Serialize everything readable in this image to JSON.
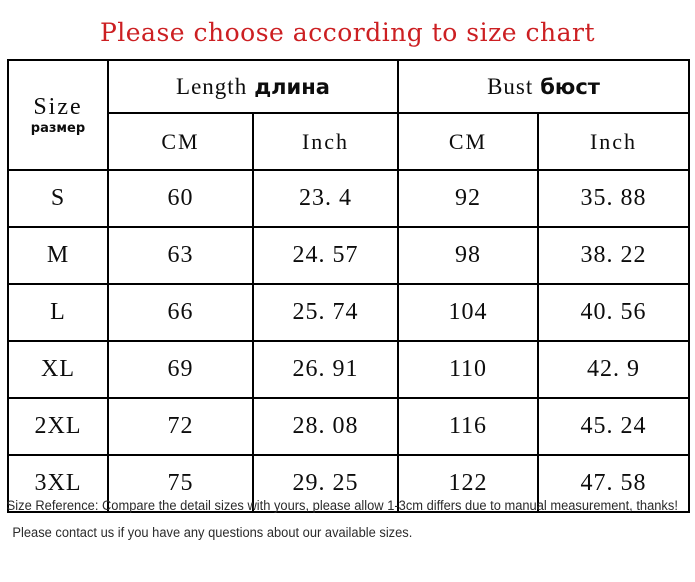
{
  "title": "Please choose according to size chart",
  "colors": {
    "title_red": "#cc1f22",
    "border": "#000000",
    "text": "#0d0d0d",
    "note_text": "#2b2b2b",
    "background": "#ffffff"
  },
  "table": {
    "size_header": {
      "english": "Size",
      "russian": "размер"
    },
    "groups": [
      {
        "english": "Length",
        "russian": "длина"
      },
      {
        "english": "Bust",
        "russian": "бюст"
      }
    ],
    "units": [
      "CM",
      "Inch",
      "CM",
      "Inch"
    ],
    "rows": [
      {
        "size": "S",
        "length_cm": "60",
        "length_inch": "23. 4",
        "bust_cm": "92",
        "bust_inch": "35. 88"
      },
      {
        "size": "M",
        "length_cm": "63",
        "length_inch": "24. 57",
        "bust_cm": "98",
        "bust_inch": "38. 22"
      },
      {
        "size": "L",
        "length_cm": "66",
        "length_inch": "25. 74",
        "bust_cm": "104",
        "bust_inch": "40. 56"
      },
      {
        "size": "XL",
        "length_cm": "69",
        "length_inch": "26. 91",
        "bust_cm": "110",
        "bust_inch": "42. 9"
      },
      {
        "size": "2XL",
        "length_cm": "72",
        "length_inch": "28. 08",
        "bust_cm": "116",
        "bust_inch": "45. 24"
      },
      {
        "size": "3XL",
        "length_cm": "75",
        "length_inch": "29. 25",
        "bust_cm": "122",
        "bust_inch": "47. 58"
      }
    ]
  },
  "notes": {
    "line1": "Size Reference: Compare the detail sizes with yours, please allow 1-3cm differs due to manual measurement, thanks!",
    "line2": "Please contact us if you have any questions about our available sizes."
  }
}
